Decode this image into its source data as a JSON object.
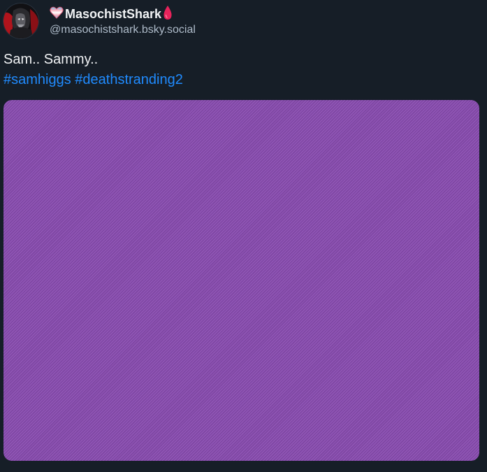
{
  "post": {
    "author": {
      "display_name": "MasochistShark",
      "handle": "@masochistshark.bsky.social",
      "prefix_icon": "heart-pride-icon",
      "suffix_icon": "blood-drop-icon"
    },
    "text": "Sam.. Sammy..",
    "hashtags": [
      "#samhiggs",
      "#deathstranding2"
    ],
    "media": {
      "color": "#8e50b7"
    }
  },
  "colors": {
    "background": "#161e27",
    "link": "#208bfe",
    "handle": "#aebbc9"
  }
}
